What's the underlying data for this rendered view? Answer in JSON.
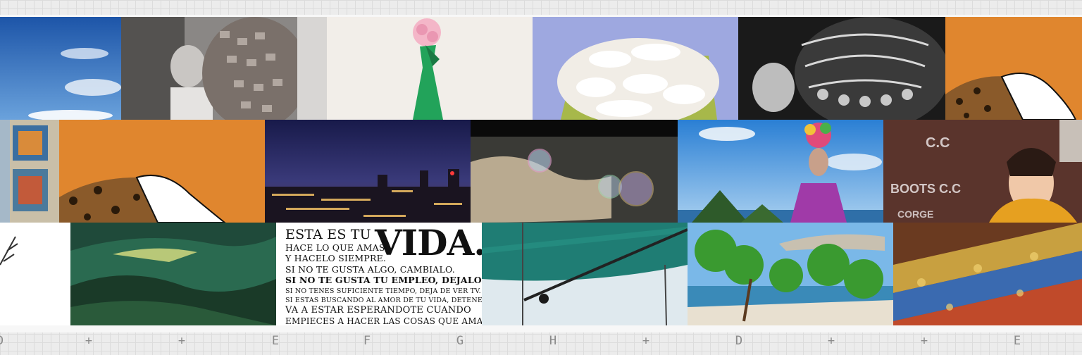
{
  "ruler": {
    "labels": [
      "D",
      "+",
      "+",
      "E",
      "F",
      "G",
      "H",
      "+",
      "D",
      "+",
      "+",
      "E"
    ]
  },
  "quote": {
    "line1": "ESTA ES TU",
    "big": "VIDA.",
    "line2": "HACE LO QUE AMAS,",
    "line3": "Y HACELO SIEMPRE.",
    "line4": "SI NO TE GUSTA ALGO, CAMBIALO.",
    "line5": "SI NO TE GUSTA TU EMPLEO, DEJALO.",
    "line6": "SI NO TENES SUFICIENTE TIEMPO, DEJA DE VER TV.",
    "line7": "SI ESTAS BUSCANDO AL AMOR DE TU VIDA, DETENETE.",
    "line8": "VA A ESTAR ESPERANDOTE CUANDO",
    "line9": "EMPIECES A HACER LAS COSAS QUE AMAS."
  },
  "sign_text": {
    "line1": "C.C",
    "line2": "BOOTS C.C",
    "line3": "CORGE"
  },
  "colors": {
    "background": "#ececec",
    "grid": "#dcdcdc",
    "ruler_text": "#8a8a8a",
    "orange": "#e0862e",
    "sky": "#3b78c4",
    "lavender": "#9ea8e0",
    "teal": "#1f7d74",
    "green": "#1a9a50"
  }
}
